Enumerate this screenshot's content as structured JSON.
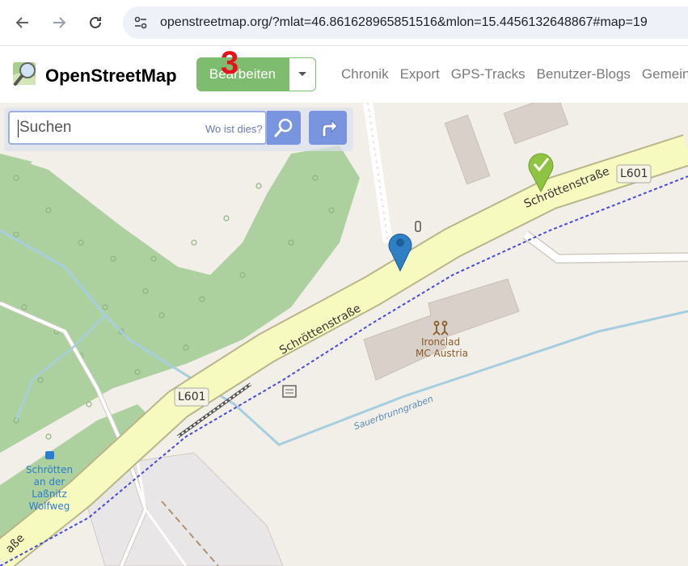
{
  "browser": {
    "url": "openstreetmap.org/?mlat=46.861628965851516&mlon=15.4456132648867#map=19"
  },
  "header": {
    "brand": "OpenStreetMap",
    "edit_label": "Bearbeiten",
    "badge": "3",
    "nav": [
      "Chronik",
      "Export",
      "GPS-Tracks",
      "Benutzer-Blogs",
      "Gemeinsc"
    ]
  },
  "search": {
    "placeholder": "Suchen",
    "where_label": "Wo ist dies?"
  },
  "map": {
    "road_name": "Schröttenstraße",
    "road_ref": "L601",
    "poi_name_1": "Ironclad",
    "poi_name_2": "MC Austria",
    "stream_name": "Sauerbrunngraben",
    "bus_stop": [
      "Schrötten",
      "an der",
      "Laßnitz",
      "Wolfweg"
    ],
    "road_end_text": "aße"
  }
}
